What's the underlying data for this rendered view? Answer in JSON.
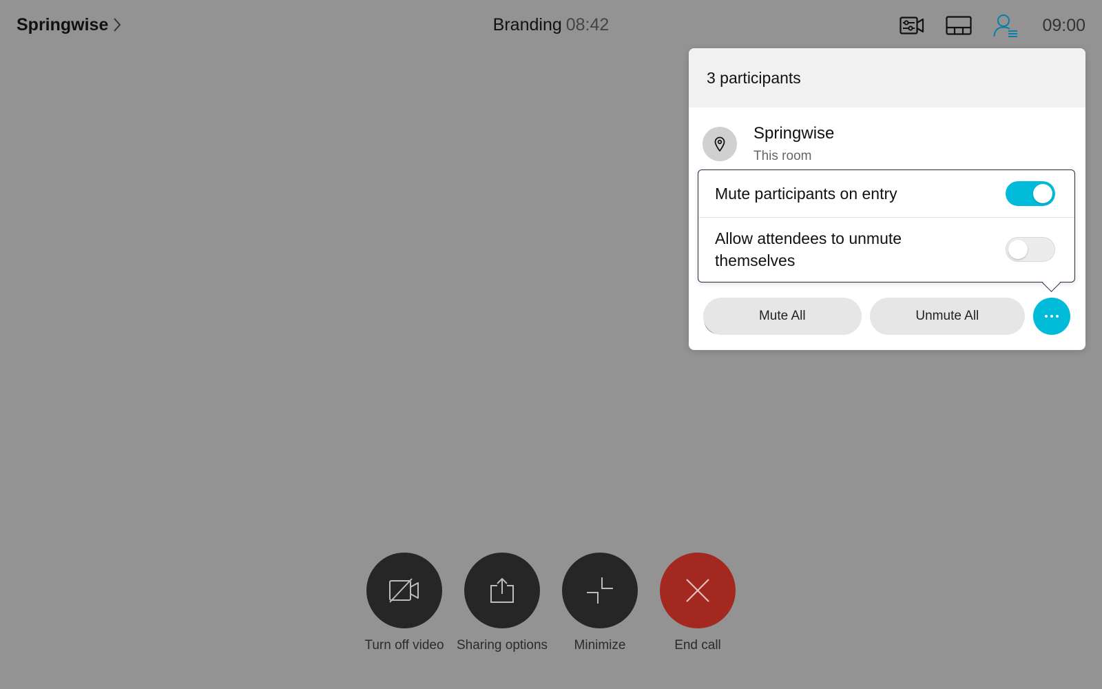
{
  "topbar": {
    "room_name": "Springwise",
    "meeting_title": "Branding",
    "meeting_timer": "08:42",
    "clock": "09:00",
    "icons": [
      "camera-controls-icon",
      "layout-icon",
      "participants-icon"
    ]
  },
  "participants_panel": {
    "header": "3 participants",
    "participants": [
      {
        "name": "Springwise",
        "subtitle": "This room",
        "icon": "location-pin-icon"
      }
    ],
    "popover": {
      "rows": [
        {
          "label": "Mute participants on entry",
          "toggle": "on"
        },
        {
          "label": "Allow attendees to unmute themselves",
          "toggle": "off"
        }
      ]
    },
    "buttons": {
      "mute_all": "Mute All",
      "unmute_all": "Unmute All",
      "more": "more-options-icon"
    }
  },
  "controls": [
    {
      "label": "Turn off video",
      "icon": "video-off-icon"
    },
    {
      "label": "Sharing options",
      "icon": "share-icon"
    },
    {
      "label": "Minimize",
      "icon": "minimize-icon"
    },
    {
      "label": "End call",
      "icon": "end-call-icon"
    }
  ],
  "colors": {
    "background": "#939393",
    "accent": "#00bcd8",
    "end_call": "#a3281f",
    "control_button": "#262626"
  }
}
